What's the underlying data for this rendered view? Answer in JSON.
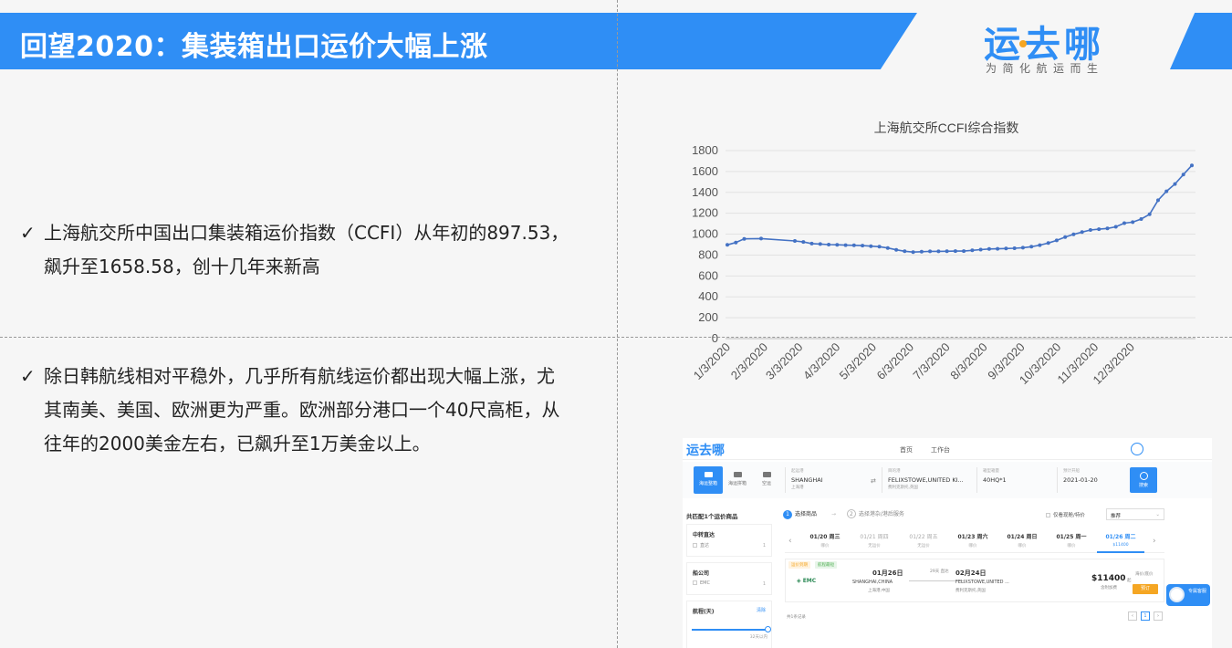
{
  "header": {
    "title": "回望2020：集装箱出口运价大幅上涨",
    "logo_text": "运去哪",
    "logo_slogan": "为简化航运而生",
    "accent_color": "#2f8ef5"
  },
  "bullets": [
    {
      "lines": [
        "上海航交所中国出口集装箱运价指数（CCFI）从年初的897.53，",
        "飙升至1658.58，创十几年来新高"
      ]
    },
    {
      "lines": [
        "除日韩航线相对平稳外，几乎所有航线运价都出现大幅上涨，尤",
        "其南美、美国、欧洲更为严重。欧洲部分港口一个40尺高柜，从",
        "往年的2000美金左右，已飙升至1万美金以上。"
      ]
    }
  ],
  "chart_data": {
    "type": "line",
    "title": "上海航交所CCFI综合指数",
    "xlabel": "",
    "ylabel": "",
    "ylim": [
      0,
      1800
    ],
    "yticks": [
      0,
      200,
      400,
      600,
      800,
      1000,
      1200,
      1400,
      1600,
      1800
    ],
    "xticks": [
      "1/3/2020",
      "2/3/2020",
      "3/3/2020",
      "4/3/2020",
      "5/3/2020",
      "6/3/2020",
      "7/3/2020",
      "8/3/2020",
      "9/3/2020",
      "10/3/2020",
      "11/3/2020",
      "12/3/2020"
    ],
    "grid": true,
    "legend": "none",
    "series_color": "#4472c4",
    "points": [
      {
        "x": "2020-01-03",
        "y": 897.53
      },
      {
        "x": "2020-01-10",
        "y": 920
      },
      {
        "x": "2020-01-17",
        "y": 955
      },
      {
        "x": "2020-01-31",
        "y": 958
      },
      {
        "x": "2020-02-28",
        "y": 935
      },
      {
        "x": "2020-03-06",
        "y": 925
      },
      {
        "x": "2020-03-13",
        "y": 910
      },
      {
        "x": "2020-03-20",
        "y": 905
      },
      {
        "x": "2020-03-27",
        "y": 900
      },
      {
        "x": "2020-04-03",
        "y": 898
      },
      {
        "x": "2020-04-10",
        "y": 895
      },
      {
        "x": "2020-04-17",
        "y": 893
      },
      {
        "x": "2020-04-24",
        "y": 890
      },
      {
        "x": "2020-05-01",
        "y": 885
      },
      {
        "x": "2020-05-08",
        "y": 880
      },
      {
        "x": "2020-05-15",
        "y": 868
      },
      {
        "x": "2020-05-22",
        "y": 850
      },
      {
        "x": "2020-05-29",
        "y": 836
      },
      {
        "x": "2020-06-05",
        "y": 828
      },
      {
        "x": "2020-06-12",
        "y": 832
      },
      {
        "x": "2020-06-19",
        "y": 835
      },
      {
        "x": "2020-06-26",
        "y": 835
      },
      {
        "x": "2020-07-03",
        "y": 836
      },
      {
        "x": "2020-07-10",
        "y": 838
      },
      {
        "x": "2020-07-17",
        "y": 838
      },
      {
        "x": "2020-07-24",
        "y": 845
      },
      {
        "x": "2020-07-31",
        "y": 852
      },
      {
        "x": "2020-08-07",
        "y": 858
      },
      {
        "x": "2020-08-14",
        "y": 860
      },
      {
        "x": "2020-08-21",
        "y": 862
      },
      {
        "x": "2020-08-28",
        "y": 865
      },
      {
        "x": "2020-09-04",
        "y": 870
      },
      {
        "x": "2020-09-11",
        "y": 880
      },
      {
        "x": "2020-09-18",
        "y": 895
      },
      {
        "x": "2020-09-25",
        "y": 915
      },
      {
        "x": "2020-10-02",
        "y": 940
      },
      {
        "x": "2020-10-09",
        "y": 972
      },
      {
        "x": "2020-10-16",
        "y": 998
      },
      {
        "x": "2020-10-23",
        "y": 1020
      },
      {
        "x": "2020-10-30",
        "y": 1040
      },
      {
        "x": "2020-11-06",
        "y": 1048
      },
      {
        "x": "2020-11-13",
        "y": 1055
      },
      {
        "x": "2020-11-20",
        "y": 1070
      },
      {
        "x": "2020-11-27",
        "y": 1105
      },
      {
        "x": "2020-12-04",
        "y": 1115
      },
      {
        "x": "2020-12-11",
        "y": 1145
      },
      {
        "x": "2020-12-18",
        "y": 1190
      },
      {
        "x": "2020-12-25",
        "y": 1325
      },
      {
        "x": "2021-01-01",
        "y": 1410
      },
      {
        "x": "2021-01-08",
        "y": 1480
      },
      {
        "x": "2021-01-15",
        "y": 1570
      },
      {
        "x": "2021-01-22",
        "y": 1658.58
      }
    ]
  },
  "app": {
    "logo": "运去哪",
    "nav": [
      "首页",
      "工作台"
    ],
    "modes": [
      "海运整箱",
      "海运拼箱",
      "空运"
    ],
    "origin": {
      "label": "起运港",
      "value": "SHANGHAI",
      "sub": "上海港"
    },
    "destination": {
      "label": "目的港",
      "value": "FELIXSTOWE,UNITED KI...",
      "sub": "费利克斯托,英国"
    },
    "box": {
      "label": "箱型箱量",
      "value": "40HQ*1"
    },
    "date": {
      "label": "预计开船",
      "value": "2021-01-20"
    },
    "search_label": "搜索",
    "match_count": "共匹配1个运价商品",
    "filters": [
      {
        "title": "中转直达",
        "option": "直达",
        "count": "1"
      },
      {
        "title": "船公司",
        "option": "EMC",
        "count": "1"
      },
      {
        "title": "航程(天)",
        "option": "清除",
        "range": "32天以内"
      }
    ],
    "steps": [
      "选择商品",
      "选择港杂/港后服务"
    ],
    "only_show": "仅看现舱/特价",
    "sort": "推荐",
    "dates": [
      {
        "d": "01/20 周三",
        "p": "哪价",
        "state": "normal"
      },
      {
        "d": "01/21 周四",
        "p": "无运价",
        "state": "dim"
      },
      {
        "d": "01/22 周五",
        "p": "无运价",
        "state": "dim"
      },
      {
        "d": "01/23 周六",
        "p": "哪价",
        "state": "normal"
      },
      {
        "d": "01/24 周日",
        "p": "哪价",
        "state": "normal"
      },
      {
        "d": "01/25 周一",
        "p": "哪价",
        "state": "normal"
      },
      {
        "d": "01/26 周二",
        "p": "$11400",
        "state": "sel"
      }
    ],
    "result": {
      "tags": [
        "运价到期",
        "航程最短"
      ],
      "carrier": "EMC",
      "etd": "01月26日",
      "pol": "SHANGHAI,CHINA",
      "pol_sub": "上海港,中国",
      "days": "29天 直达",
      "eta": "02月24日",
      "pod": "FELIXSTOWE,UNITED ...",
      "pod_sub": "费利克斯托,英国",
      "price": "$11400",
      "price_unit": "起",
      "price_note": "含附加费",
      "price_tag": "海价/底价",
      "book": "预订"
    },
    "record_count": "共1条记录",
    "page": "1",
    "service": "专属客服"
  }
}
